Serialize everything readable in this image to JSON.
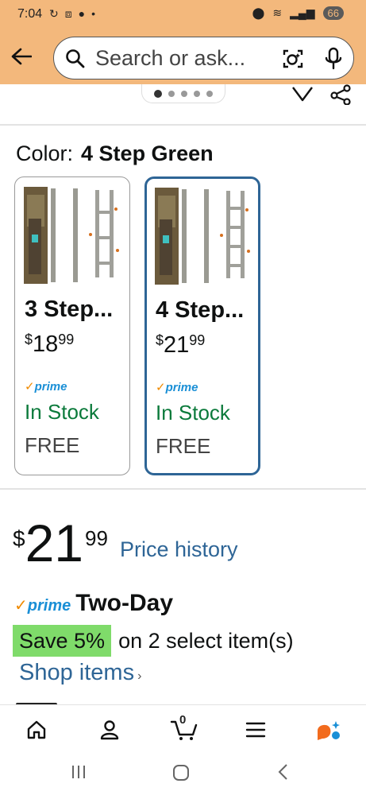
{
  "status_bar": {
    "time": "7:04",
    "battery": "66"
  },
  "search": {
    "placeholder": "Search or ask..."
  },
  "carousel": {
    "dot_count": 5,
    "active_index": 0
  },
  "color_selector": {
    "label": "Color:",
    "selected_value": "4 Step Green",
    "variants": [
      {
        "name": "3 Step...",
        "price_currency": "$",
        "price_whole": "18",
        "price_fraction": "99",
        "prime": "prime",
        "stock": "In Stock",
        "shipping": "FREE",
        "selected": false
      },
      {
        "name": "4 Step...",
        "price_currency": "$",
        "price_whole": "21",
        "price_fraction": "99",
        "prime": "prime",
        "stock": "In Stock",
        "shipping": "FREE",
        "selected": true
      }
    ]
  },
  "price": {
    "currency": "$",
    "whole": "21",
    "fraction": "99",
    "history_link": "Price history"
  },
  "delivery": {
    "prime_logo": "prime",
    "speed": "Two-Day"
  },
  "promotion": {
    "badge": "Save 5%",
    "text": "on 2 select item(s)",
    "link": "Shop items"
  },
  "bottom_nav": {
    "cart_count": "0"
  },
  "colors": {
    "header_bg": "#f3b87c",
    "link_blue": "#2e6596",
    "stock_green": "#0b7a3b",
    "save_badge": "#7fdb6a",
    "prime_blue": "#1a8fd6",
    "prime_check": "#f08a00"
  }
}
